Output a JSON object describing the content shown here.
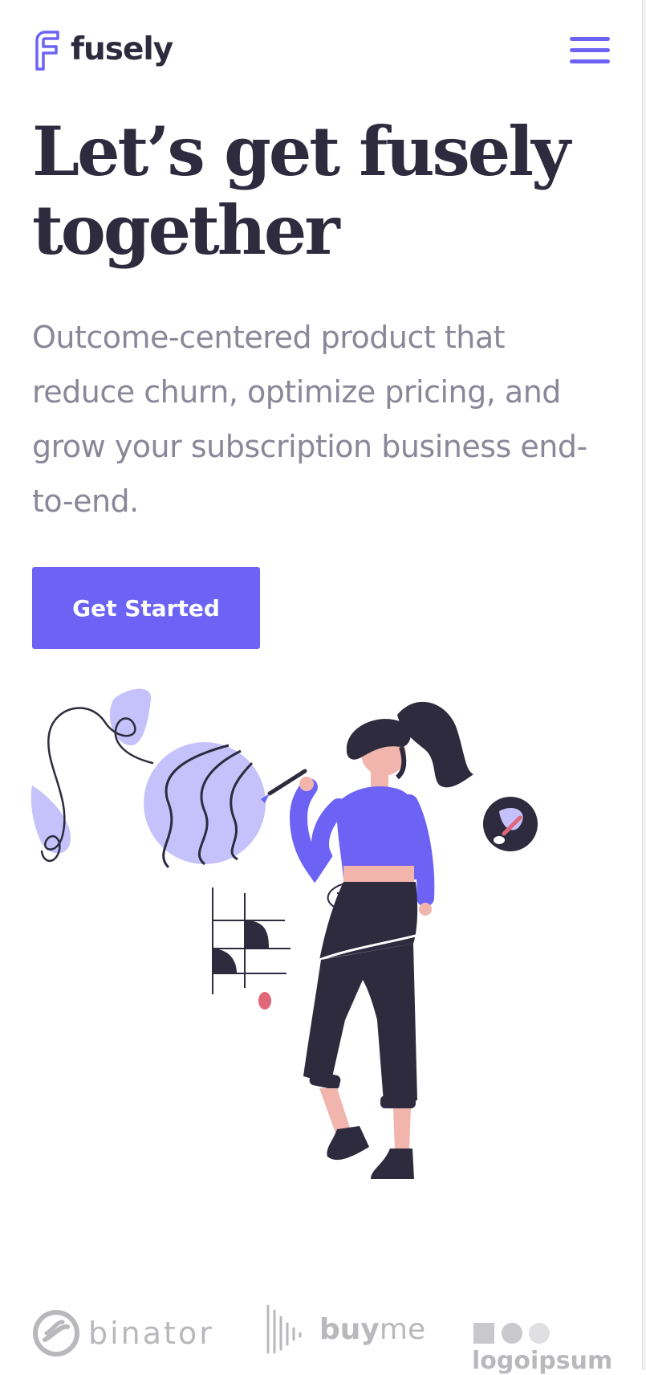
{
  "header": {
    "brand": "fusely",
    "logo_icon": "fusely-f-logo",
    "menu_icon": "hamburger-menu-icon"
  },
  "hero": {
    "title": "Let’s get fusely together",
    "subtitle": "Outcome-centered product that reduce churn, optimize pricing, and grow your subscription business end-to-end.",
    "cta_label": "Get Started",
    "illustration": "woman-painting-illustration"
  },
  "partners": [
    {
      "name": "binator",
      "icon": "binator-logo-icon"
    },
    {
      "name_bold": "buy",
      "name_light": "me",
      "icon": "soundwave-logo-icon"
    },
    {
      "name": "logoipsum",
      "icon": "square-circles-logo-icon"
    }
  ],
  "colors": {
    "accent": "#6c63f5",
    "accent_light": "#c5c2fb",
    "dark": "#2d2b3d",
    "muted": "#8a8799",
    "skin": "#f2b5ae",
    "pink": "#e0667a"
  }
}
